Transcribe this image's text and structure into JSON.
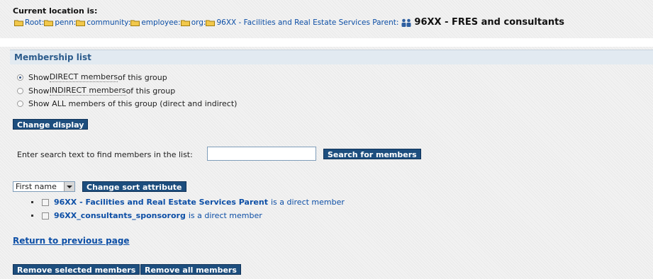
{
  "location": {
    "label": "Current location is:",
    "breadcrumbs": [
      {
        "name": "Root:"
      },
      {
        "name": "penn:"
      },
      {
        "name": "community:"
      },
      {
        "name": "employee:"
      },
      {
        "name": "org:"
      },
      {
        "name": "96XX - Facilities and Real Estate Services Parent:"
      }
    ],
    "current_group": "96XX - FRES and consultants"
  },
  "membership": {
    "title": "Membership list",
    "radios": [
      {
        "prefix": "Show ",
        "dotted": "DIRECT members",
        "suffix": " of this group",
        "checked": true
      },
      {
        "prefix": "Show ",
        "dotted": "INDIRECT members",
        "suffix": " of this group",
        "checked": false
      },
      {
        "prefix": "Show ALL members of this group (direct and indirect)",
        "dotted": "",
        "suffix": "",
        "checked": false
      }
    ],
    "change_display_label": "Change display",
    "search_label": "Enter search text to find members in the list:",
    "search_value": "",
    "search_button_label": "Search for members",
    "sort_selected": "First name",
    "change_sort_label": "Change sort attribute",
    "members": [
      {
        "name": "96XX - Facilities and Real Estate Services Parent",
        "desc": "is a direct member"
      },
      {
        "name": "96XX_consultants_sponsororg",
        "desc": "is a direct member"
      }
    ],
    "return_link": "Return to previous page",
    "remove_selected_label": "Remove selected members",
    "remove_all_label": "Remove all members"
  },
  "colors": {
    "button_bg": "#1d4e7e",
    "link": "#0d4fa6",
    "header_bg": "#e2eaf1",
    "title": "#2c5c8c"
  },
  "icons": {
    "breadcrumb": "folder-icon",
    "current_group": "group-icon"
  }
}
